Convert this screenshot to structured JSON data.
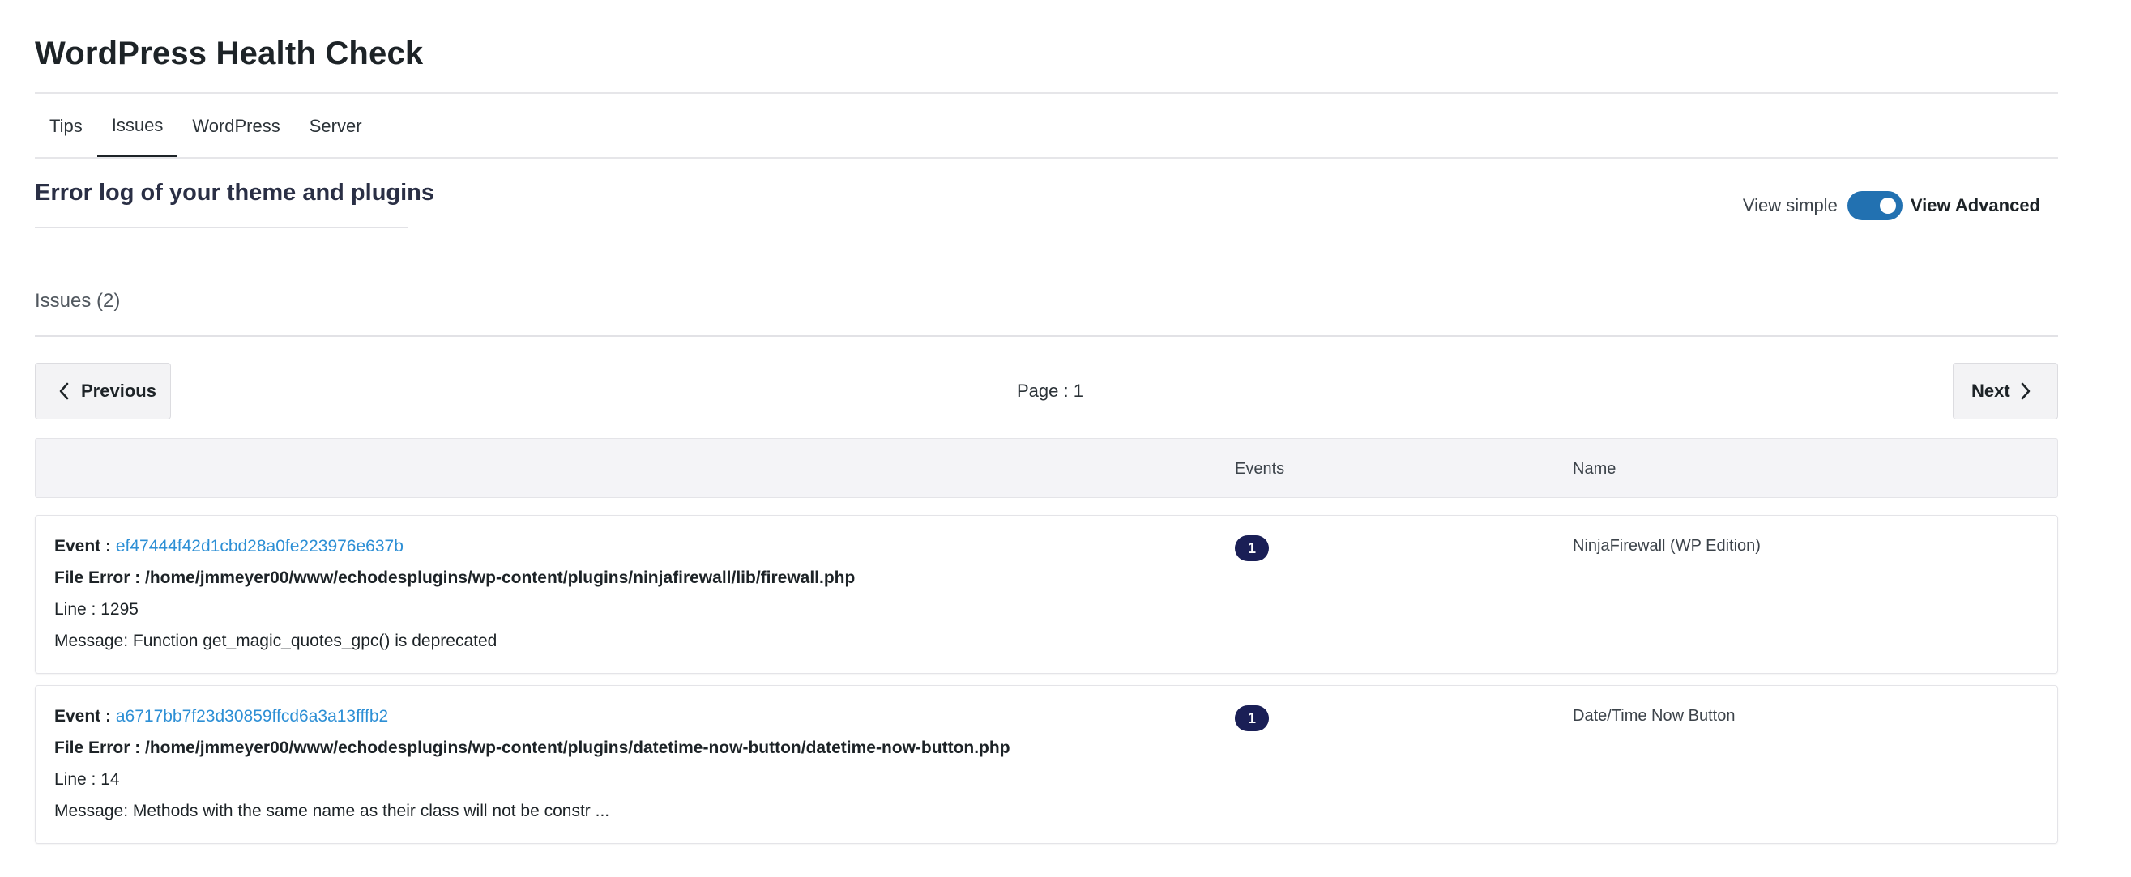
{
  "page": {
    "title": "WordPress Health Check"
  },
  "tabs": [
    {
      "label": "Tips",
      "active": false
    },
    {
      "label": "Issues",
      "active": true
    },
    {
      "label": "WordPress",
      "active": false
    },
    {
      "label": "Server",
      "active": false
    }
  ],
  "section": {
    "title": "Error log of your theme and plugins"
  },
  "view_toggle": {
    "simple_label": "View simple",
    "advanced_label": "View Advanced",
    "advanced_on": true
  },
  "issues": {
    "count_label": "Issues (2)"
  },
  "pagination": {
    "previous_label": "Previous",
    "next_label": "Next",
    "page_label": "Page : 1"
  },
  "table": {
    "columns": {
      "events": "Events",
      "name": "Name"
    },
    "rows": [
      {
        "event_prefix": "Event :",
        "event_id": "ef47444f42d1cbd28a0fe223976e637b",
        "file_error": "File Error : /home/jmmeyer00/www/echodesplugins/wp-content/plugins/ninjafirewall/lib/firewall.php",
        "line": "Line : 1295",
        "message": "Message: Function get_magic_quotes_gpc() is deprecated",
        "events": "1",
        "name": "NinjaFirewall (WP Edition)"
      },
      {
        "event_prefix": "Event :",
        "event_id": "a6717bb7f23d30859ffcd6a3a13fffb2",
        "file_error": "File Error : /home/jmmeyer00/www/echodesplugins/wp-content/plugins/datetime-now-button/datetime-now-button.php",
        "line": "Line : 14",
        "message": "Message: Methods with the same name as their class will not be constr ...",
        "events": "1",
        "name": "Date/Time Now Button"
      }
    ]
  },
  "colors": {
    "accent": "#2271b1",
    "link": "#2d8fd5",
    "badge": "#1a1f56"
  }
}
